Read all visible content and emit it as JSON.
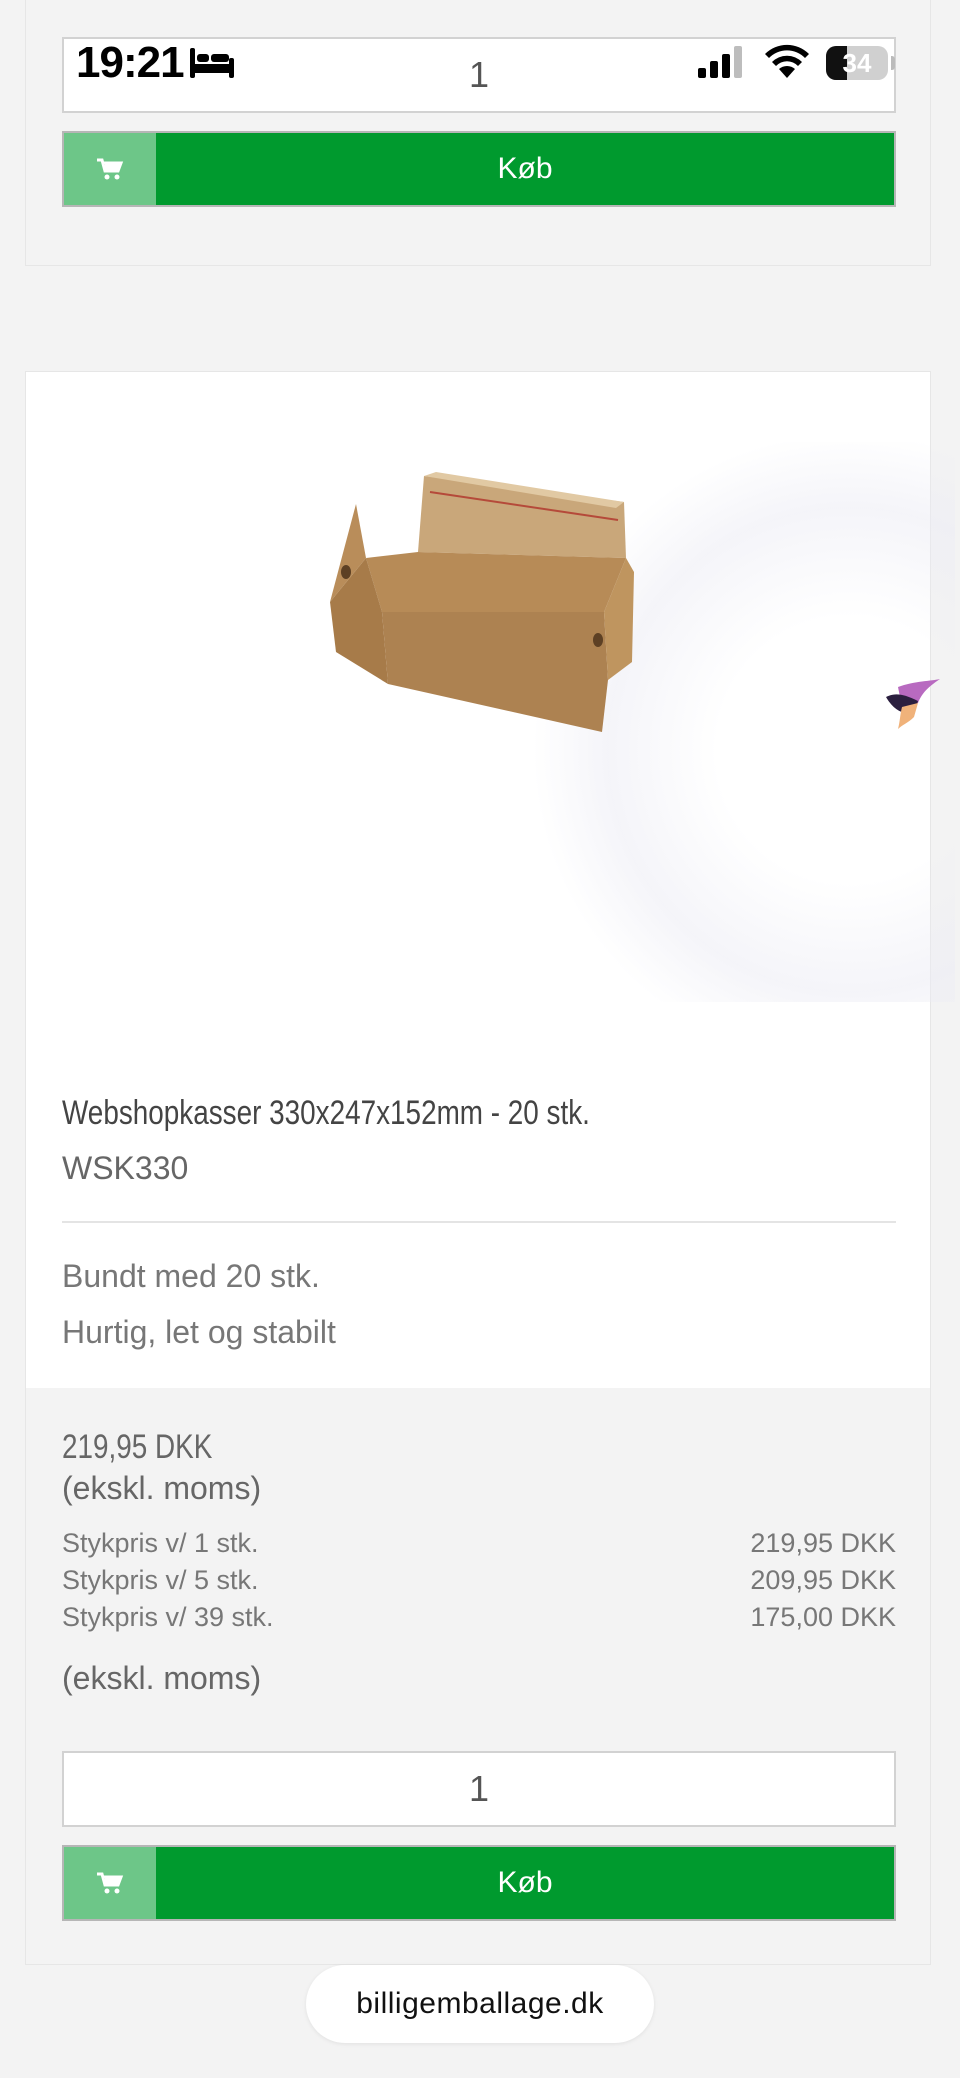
{
  "status_bar": {
    "time": "19:21",
    "battery": "34",
    "battery_level": 0.34,
    "icons": [
      "bed-icon",
      "cellular-signal-icon",
      "wifi-icon",
      "battery-icon"
    ]
  },
  "top_card": {
    "quantity": "1",
    "buy_label": "Køb"
  },
  "product": {
    "image": "cardboard-box",
    "title": "Webshopkasser 330x247x152mm - 20 stk.",
    "sku": "WSK330",
    "descriptions": [
      "Bundt med 20 stk.",
      "Hurtig, let og stabilt"
    ],
    "price": "219,95 DKK",
    "vat_note": "(ekskl. moms)",
    "tiers": [
      {
        "label": "Stykpris v/ 1 stk.",
        "price": "219,95 DKK"
      },
      {
        "label": "Stykpris v/ 5 stk.",
        "price": "209,95 DKK"
      },
      {
        "label": "Stykpris v/ 39 stk.",
        "price": "175,00 DKK"
      }
    ],
    "vat_note_2": "(ekskl. moms)",
    "quantity": "1",
    "buy_label": "Køb"
  },
  "browser": {
    "url": "billigemballage.dk"
  },
  "colors": {
    "buy_green": "#009a2e",
    "cart_green": "#6dc688",
    "page_bg": "#f3f3f3"
  }
}
